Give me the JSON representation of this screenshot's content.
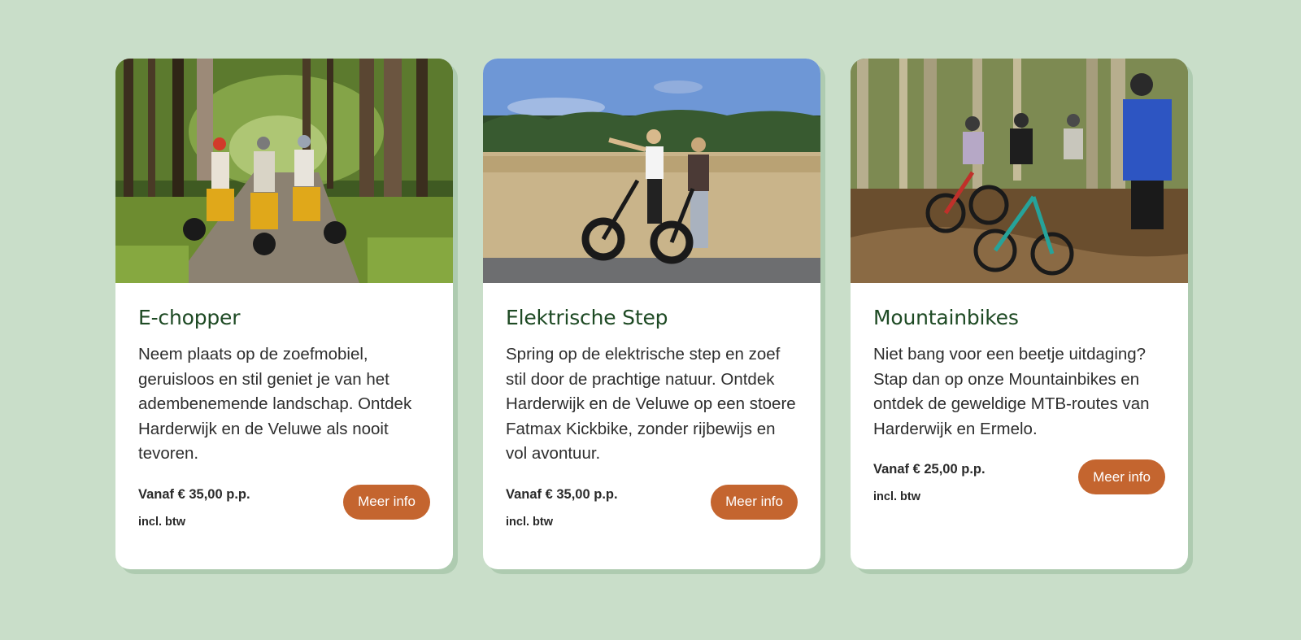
{
  "colors": {
    "background": "#c9dec9",
    "card": "#ffffff",
    "title": "#1e4a24",
    "button": "#c4652f",
    "shadow": "#aecbb0"
  },
  "cards": [
    {
      "title": "E-chopper",
      "description": "Neem plaats op de zoefmobiel, geruisloos en stil geniet je van het adembenemende landschap. Ontdek Harderwijk en de Veluwe als nooit tevoren.",
      "price": "Vanaf € 35,00 p.p.",
      "vat": "incl. btw",
      "button": "Meer info"
    },
    {
      "title": "Elektrische Step",
      "description": "Spring op de elektrische step en zoef stil door de prachtige natuur. Ontdek Harderwijk en de Veluwe op een stoere Fatmax Kickbike, zonder rijbewijs en vol avontuur.",
      "price": "Vanaf € 35,00 p.p.",
      "vat": "incl. btw",
      "button": "Meer info"
    },
    {
      "title": "Mountainbikes",
      "description": "Niet bang voor een beetje uitdaging? Stap dan op onze Mountainbikes en ontdek de geweldige MTB-routes van Harderwijk en Ermelo.",
      "price": "Vanaf € 25,00 p.p.",
      "vat": "incl. btw",
      "button": "Meer info"
    }
  ]
}
